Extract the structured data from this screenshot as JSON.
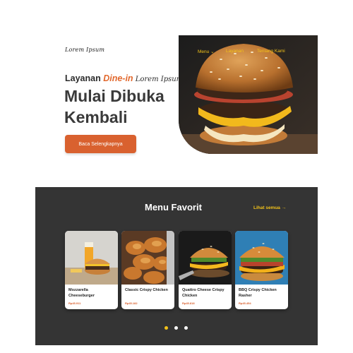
{
  "brand": {
    "logo_text": "Lorem Ipsum"
  },
  "hero": {
    "tagline_prefix": "Layanan ",
    "tagline_accent": "Dine-in",
    "tagline_script": " Lorem Ipsum",
    "headline_line1": "Mulai Dibuka",
    "headline_line2": "Kembali",
    "cta_label": "Baca Selengkapnya"
  },
  "nav": {
    "items": [
      "Menu",
      "Layanan",
      "Tentang Kami"
    ]
  },
  "menu_section": {
    "title": "Menu Favorit",
    "see_all_label": "Lihat semua →",
    "cards": [
      {
        "name": "Mozzarella Cheeseburger",
        "price": "Rp45.911"
      },
      {
        "name": "Classic Crispy Chicken",
        "price": "Rp45.182"
      },
      {
        "name": "Quattro Cheese Crispy Chicken",
        "price": "Rp45.818"
      },
      {
        "name": "BBQ Crispy Chicken Rasher",
        "price": "Rp45.454"
      }
    ],
    "pagination": {
      "pages": 3,
      "active": 1
    }
  },
  "colors": {
    "accent_orange": "#d9612f",
    "accent_yellow": "#f2c21a",
    "dark_section": "#343434"
  }
}
